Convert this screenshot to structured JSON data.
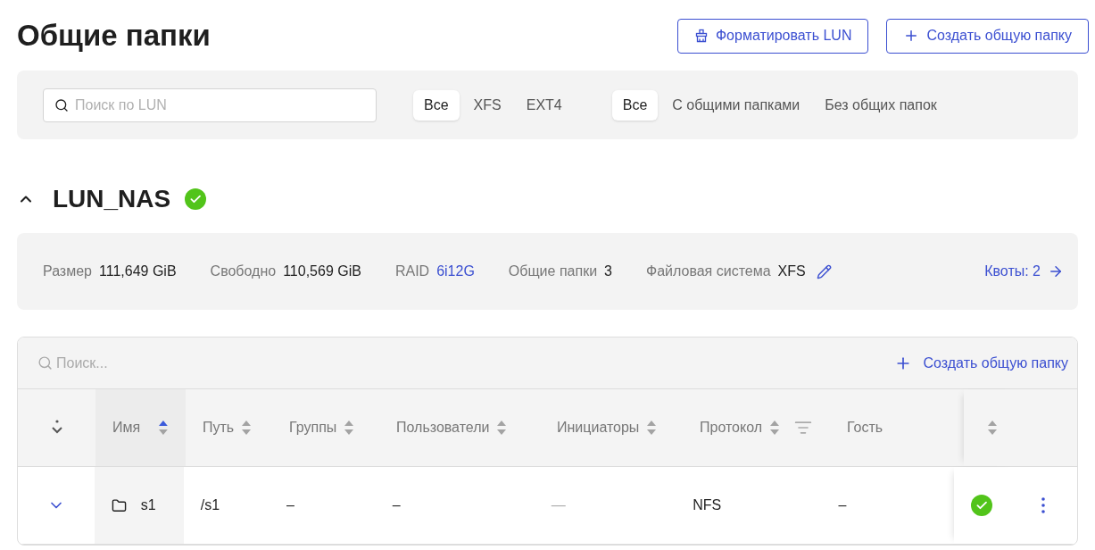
{
  "page_title": "Общие папки",
  "header_buttons": [
    {
      "kind": "format",
      "label": "Форматировать LUN"
    },
    {
      "kind": "create",
      "label": "Создать общую папку"
    }
  ],
  "filter_bar": {
    "search": {
      "placeholder": "Поиск по LUN"
    },
    "fs_filter": [
      {
        "label": "Все",
        "selected": true
      },
      {
        "label": "XFS",
        "selected": false
      },
      {
        "label": "EXT4",
        "selected": false
      }
    ],
    "folder_filter": [
      {
        "label": "Все",
        "selected": true
      },
      {
        "label": "С общими папками",
        "selected": false
      },
      {
        "label": "Без общих папок",
        "selected": false
      }
    ]
  },
  "lun": {
    "name": "LUN_NAS",
    "expanded": true,
    "healthy": true,
    "stats": [
      {
        "label": "Размер",
        "value": "111,649 GiB",
        "kind": "plain"
      },
      {
        "label": "Свободно",
        "value": "110,569 GiB",
        "kind": "plain"
      },
      {
        "label": "RAID",
        "value": "6i12G",
        "kind": "link"
      },
      {
        "label": "Общие папки",
        "value": "3",
        "kind": "plain"
      },
      {
        "label": "Файловая система",
        "value": "XFS",
        "kind": "editable"
      }
    ],
    "quotas_link": "Квоты: 2"
  },
  "table": {
    "search": {
      "placeholder": "Поиск..."
    },
    "create_link": "Создать общую папку",
    "columns": [
      {
        "label": "Имя",
        "sorted": true
      },
      {
        "label": "Путь",
        "sorted": false
      },
      {
        "label": "Группы",
        "sorted": false
      },
      {
        "label": "Пользователи",
        "sorted": false
      },
      {
        "label": "Инициаторы",
        "sorted": false
      },
      {
        "label": "Протокол",
        "sorted": false,
        "filter": true
      },
      {
        "label": "Гость"
      },
      {
        "sorted": false
      }
    ],
    "rows": [
      {
        "expanded": false,
        "name": "s1",
        "path": "/s1",
        "groups": "–",
        "users": "–",
        "initiators": "—",
        "protocol": "NFS",
        "guest": "–",
        "healthy": true
      }
    ]
  }
}
